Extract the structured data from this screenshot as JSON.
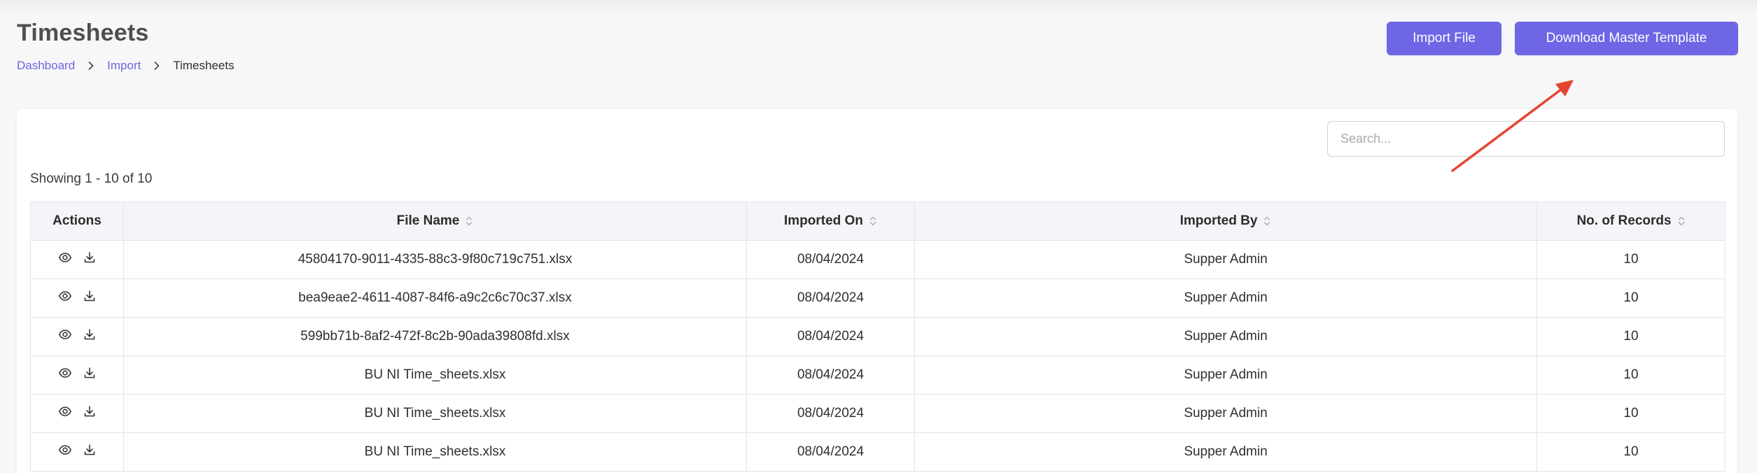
{
  "page": {
    "title": "Timesheets",
    "breadcrumb": [
      {
        "label": "Dashboard"
      },
      {
        "label": "Import"
      },
      {
        "label": "Timesheets"
      }
    ]
  },
  "toolbar": {
    "import_label": "Import File",
    "download_label": "Download Master Template"
  },
  "search": {
    "placeholder": "Search..."
  },
  "table": {
    "showing": "Showing 1 - 10 of 10",
    "columns": [
      "Actions",
      "File Name",
      "Imported On",
      "Imported By",
      "No. of Records"
    ],
    "rows": [
      {
        "file_name": "45804170-9011-4335-88c3-9f80c719c751.xlsx",
        "imported_on": "08/04/2024",
        "imported_by": "Supper Admin",
        "records": "10"
      },
      {
        "file_name": "bea9eae2-4611-4087-84f6-a9c2c6c70c37.xlsx",
        "imported_on": "08/04/2024",
        "imported_by": "Supper Admin",
        "records": "10"
      },
      {
        "file_name": "599bb71b-8af2-472f-8c2b-90ada39808fd.xlsx",
        "imported_on": "08/04/2024",
        "imported_by": "Supper Admin",
        "records": "10"
      },
      {
        "file_name": "BU NI Time_sheets.xlsx",
        "imported_on": "08/04/2024",
        "imported_by": "Supper Admin",
        "records": "10"
      },
      {
        "file_name": "BU NI Time_sheets.xlsx",
        "imported_on": "08/04/2024",
        "imported_by": "Supper Admin",
        "records": "10"
      },
      {
        "file_name": "BU NI Time_sheets.xlsx",
        "imported_on": "08/04/2024",
        "imported_by": "Supper Admin",
        "records": "10"
      }
    ]
  },
  "icons": {
    "row_view": "eye-icon",
    "row_download": "download-icon",
    "sort": "sort-icon",
    "breadcrumb_separator": "chevron-right-icon"
  },
  "colors": {
    "accent": "#6f66e5",
    "link": "#6c66e0",
    "annotation_arrow": "#e5452f",
    "background": "#f7f7f8"
  }
}
